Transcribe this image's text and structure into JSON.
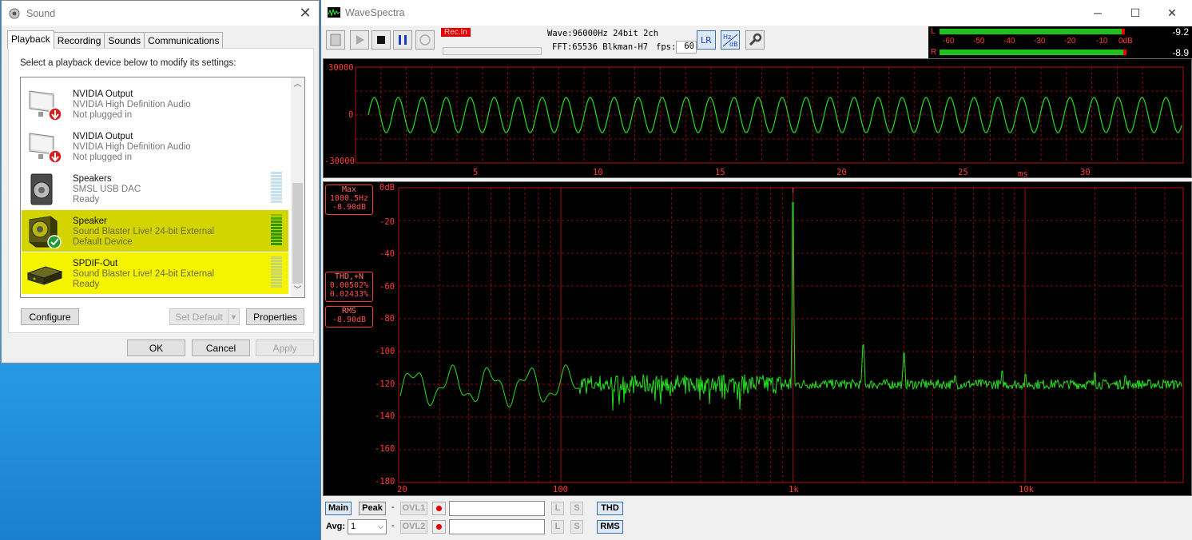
{
  "sound": {
    "title": "Sound",
    "tabs": [
      "Playback",
      "Recording",
      "Sounds",
      "Communications"
    ],
    "instruction": "Select a playback device below to modify its settings:",
    "devices": [
      {
        "name": "NVIDIA Output",
        "line1": "NVIDIA High Definition Audio",
        "line2": "Not plugged in",
        "icon": "monitor-unplugged-icon"
      },
      {
        "name": "NVIDIA Output",
        "line1": "NVIDIA High Definition Audio",
        "line2": "Not plugged in",
        "icon": "monitor-unplugged-icon"
      },
      {
        "name": "Speakers",
        "line1": "SMSL USB DAC",
        "line2": "Ready",
        "icon": "speaker-icon"
      },
      {
        "name": "Speaker",
        "line1": "Sound Blaster Live! 24-bit External",
        "line2": "Default Device",
        "icon": "speaker-default-icon"
      },
      {
        "name": "SPDIF-Out",
        "line1": "Sound Blaster Live! 24-bit External",
        "line2": "Ready",
        "icon": "spdif-device-icon"
      }
    ],
    "buttons": {
      "configure": "Configure",
      "set_default": "Set Default",
      "properties": "Properties",
      "ok": "OK",
      "cancel": "Cancel",
      "apply": "Apply"
    }
  },
  "ws": {
    "title": "WaveSpectra",
    "rec_in": "Rec.In",
    "wave": "Wave:96000Hz 24bit 2ch",
    "fft": "FFT:65536 Blkman-H7",
    "fps_label": "fps:",
    "fps": "60",
    "vu": {
      "l_label": "L",
      "r_label": "R",
      "scale": [
        "-60",
        "-50",
        "-40",
        "-30",
        "-20",
        "-10",
        "0dB"
      ],
      "l_value": "-9.2",
      "r_value": "-8.9",
      "l_level": 0.85,
      "r_level": 0.86
    },
    "wave_plot": {
      "y_ticks": [
        "30000",
        "0",
        "-30000"
      ],
      "x_ticks": [
        "5",
        "10",
        "15",
        "20",
        "25",
        "30"
      ],
      "x_unit": "ms"
    },
    "spec_plot": {
      "y_ticks": [
        "0dB",
        "-20",
        "-40",
        "-60",
        "-80",
        "-100",
        "-120",
        "-140",
        "-160",
        "-180"
      ],
      "x_ticks": [
        "20",
        "100",
        "1k",
        "10k"
      ],
      "max_label": "Max",
      "max_freq": "1000.5Hz",
      "max_db": "-8.90dB",
      "thd_label": "THD,+N",
      "thd_value": "0.00502%",
      "thdn_value": "0.02433%",
      "rms_label": "RMS",
      "rms_value": "-8.90dB"
    },
    "bottom": {
      "main": "Main",
      "peak": "Peak",
      "dash": "-",
      "ovl1": "OVL1",
      "ovl2": "OVL2",
      "l": "L",
      "s": "S",
      "thd": "THD",
      "rms": "RMS",
      "avg_label": "Avg:",
      "avg_value": "1"
    },
    "colors": {
      "trace": "#22e022",
      "grid": "#b01010",
      "label": "#ff3a3a"
    }
  }
}
